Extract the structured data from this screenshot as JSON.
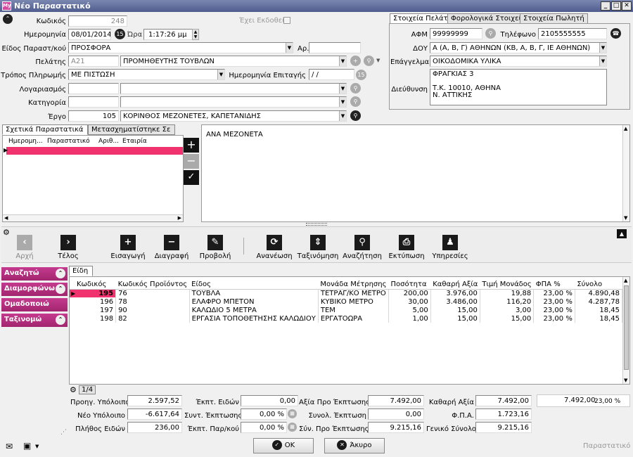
{
  "window": {
    "title": "Νέο Παραστατικό",
    "icon_label": "My"
  },
  "header": {
    "code_label": "Κωδικός",
    "code_value": "248",
    "issued_label": "Έχει Εκδοθεί",
    "date_label": "Ημερομηνία",
    "date_value": "08/01/2014",
    "time_label": "Ώρα",
    "time_value": "1:17:26 μμ",
    "doctype_label": "Είδος Παραστ/κού",
    "doctype_value": "ΠΡΟΣΦΟΡΑ",
    "number_label": "Αρ.",
    "customer_label": "Πελάτης",
    "customer_code": "Α21",
    "customer_name": "ΠΡΟΜΗΘΕΥΤΗΣ ΤΟΥΒΛΩΝ",
    "payment_label": "Τρόπος Πληρωμής",
    "payment_value": "ΜΕ ΠΙΣΤΩΣΗ",
    "check_date_label": "Ημερομηνία Επιταγής",
    "check_date_value": " /  /",
    "account_label": "Λογαριασμός",
    "category_label": "Κατηγορία",
    "project_label": "Έργο",
    "project_code": "105",
    "project_name": "ΚΟΡΙΝΘΟΣ ΜΕΖΟΝΕΤΕΣ, ΚΑΠΕΤΑΝΙΔΗΣ",
    "calendar_icon": "15"
  },
  "customer_panel": {
    "tabs": [
      "Στοιχεία Πελάτη",
      "Φορολογικά Στοιχεία",
      "Στοιχεία Πωλητή"
    ],
    "afm_label": "ΑΦΜ",
    "afm_value": "99999999",
    "phone_label": "Τηλέφωνο",
    "phone_value": "2105555555",
    "doy_label": "ΔΟΥ",
    "doy_value": "Α (Α, Β, Γ) ΑΘΗΝΩΝ (ΚΒ, Α, Β, Γ, ΙΕ ΑΘΗΝΩΝ)",
    "profession_label": "Επάγγελμα",
    "profession_value": "ΟΙΚΟΔΟΜΙΚΑ ΥΛΙΚΑ",
    "address_label": "Διεύθυνση",
    "address_lines": [
      "ΦΡΑΓΚΙΑΣ 3",
      "",
      "Τ.Κ. 10010, ΑΘΗΝΑ",
      "Ν. ΑΤΤΙΚΗΣ"
    ]
  },
  "related": {
    "tabs": [
      "Σχετικά Παραστατικά",
      "Μετασχηματίστηκε Σε"
    ],
    "columns": [
      "Ημερομη...",
      "Παραστατικό",
      "Αριθ...",
      "Εταιρία"
    ]
  },
  "notes": {
    "text": "ΑΝΑ ΜΕΖΟΝΕΤΑ"
  },
  "toolbar": {
    "items": [
      {
        "label": "Αρχή",
        "icon": "‹",
        "disabled": true
      },
      {
        "label": "Τέλος",
        "icon": "›",
        "disabled": false
      },
      {
        "label": "Εισαγωγή",
        "icon": "+",
        "disabled": false
      },
      {
        "label": "Διαγραφή",
        "icon": "−",
        "disabled": false
      },
      {
        "label": "Προβολή",
        "icon": "✎",
        "disabled": false
      },
      {
        "label": "Ανανέωση",
        "icon": "⟳",
        "disabled": false
      },
      {
        "label": "Ταξινόμηση",
        "icon": "⇕",
        "disabled": false
      },
      {
        "label": "Αναζήτηση",
        "icon": "⚲",
        "disabled": false
      },
      {
        "label": "Εκτύπωση",
        "icon": "⎙",
        "disabled": false
      },
      {
        "label": "Υπηρεσίες",
        "icon": "♟",
        "disabled": false
      }
    ]
  },
  "sidebar": {
    "items": [
      "Αναζητώ",
      "Διαμορφώνω",
      "Ομαδοποιώ",
      "Ταξινομώ"
    ]
  },
  "items_tab": "Είδη",
  "grid": {
    "columns": [
      "Κωδικός",
      "Κωδικός Προϊόντος",
      "Είδος",
      "Μονάδα Μέτρησης",
      "Ποσότητα",
      "Καθαρή Αξία",
      "Τιμή Μονάδος",
      "ΦΠΑ %",
      "Σύνολο"
    ],
    "rows": [
      [
        "195",
        "76",
        "ΤΟΥΒΛΑ",
        "ΤΕΤΡΑΓ/ΚΟ ΜΕΤΡΟ",
        "200,00",
        "3.976,00",
        "19,88",
        "23,00 %",
        "4.890,48"
      ],
      [
        "196",
        "78",
        "ΕΛΑΦΡΟ ΜΠΕΤΟΝ",
        "ΚΥΒΙΚΟ ΜΕΤΡΟ",
        "30,00",
        "3.486,00",
        "116,20",
        "23,00 %",
        "4.287,78"
      ],
      [
        "197",
        "90",
        "ΚΑΛΩΔΙΟ 5 ΜΕΤΡΑ",
        "ΤΕΜ",
        "5,00",
        "15,00",
        "3,00",
        "23,00 %",
        "18,45"
      ],
      [
        "198",
        "82",
        "ΕΡΓΑΣΙΑ ΤΟΠΟΘΕΤΗΣΗΣ ΚΑΛΩΔΙΟΥ",
        "ΕΡΓΑΤΟΩΡΑ",
        "1,00",
        "15,00",
        "15,00",
        "23,00 %",
        "18,45"
      ]
    ],
    "page": "1/4"
  },
  "totals": {
    "prev_balance_label": "Προηγ. Υπόλοιπο",
    "prev_balance": "2.597,52",
    "new_balance_label": "Νέο Υπόλοιπο",
    "new_balance": "-6.617,64",
    "qty_label": "Πλήθος Ειδών",
    "qty": "236,00",
    "item_disc_label": "Έκπτ. Ειδών",
    "item_disc": "0,00",
    "disc_rate_label": "Συντ. Έκπτωσης",
    "disc_rate": "0,00 %",
    "doc_disc_label": "Έκπτ. Παρ/κού",
    "doc_disc": "0,00 %",
    "before_disc_label": "Αξία Προ Έκπτωσης",
    "before_disc": "7.492,00",
    "total_disc_label": "Συνολ. Έκπτωση",
    "total_disc": "0,00",
    "sum_before_label": "Σύν. Προ Έκπτωσης",
    "sum_before": "9.215,16",
    "net_label": "Καθαρή Αξία",
    "net": "7.492,00",
    "vat_label": "Φ.Π.Α.",
    "vat": "1.723,16",
    "grand_label": "Γενικό Σύνολο",
    "grand": "9.215,16",
    "vat_net": "7.492,00",
    "vat_rate": "23,00 %"
  },
  "footer": {
    "ok": "OK",
    "cancel": "Άκυρο",
    "status": "Παραστατικό"
  }
}
